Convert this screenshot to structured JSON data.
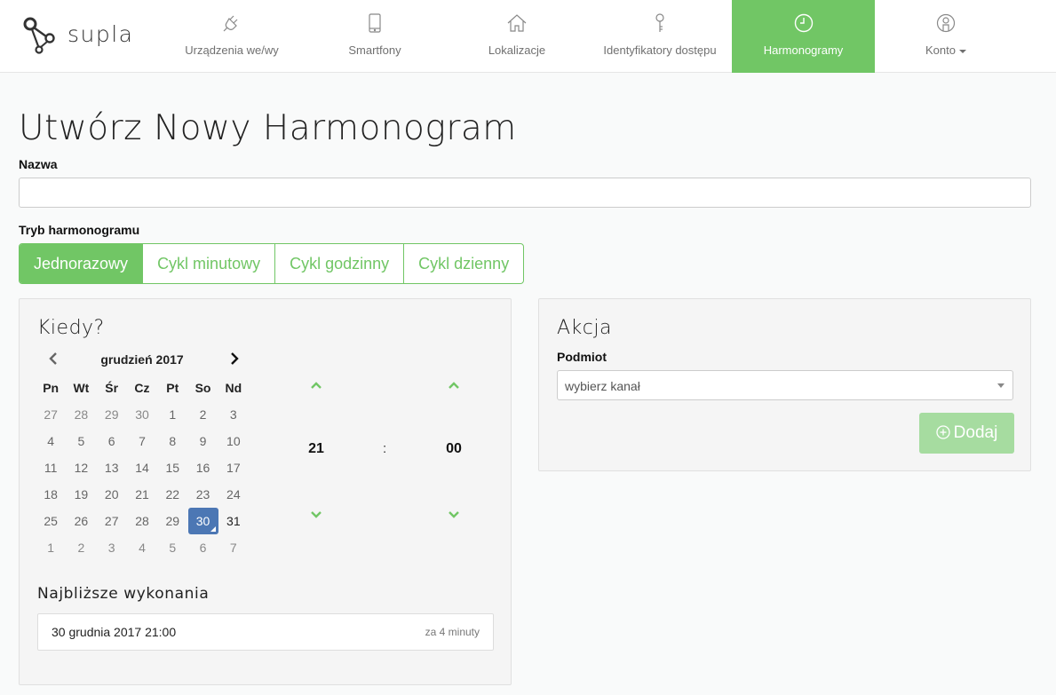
{
  "app": {
    "logo_text": "supla"
  },
  "nav": {
    "items": [
      {
        "label": "Urządzenia we/wy",
        "icon": "plug-icon"
      },
      {
        "label": "Smartfony",
        "icon": "smartphone-icon"
      },
      {
        "label": "Lokalizacje",
        "icon": "home-icon"
      },
      {
        "label": "Identyfikatory dostępu",
        "icon": "key-icon"
      },
      {
        "label": "Harmonogramy",
        "icon": "clock-icon",
        "active": true
      },
      {
        "label": "Konto",
        "icon": "user-icon",
        "dropdown": true
      }
    ]
  },
  "page": {
    "title": "Utwórz Nowy Harmonogram"
  },
  "form": {
    "name_label": "Nazwa",
    "name_value": "",
    "mode_label": "Tryb harmonogramu",
    "modes": [
      "Jednorazowy",
      "Cykl minutowy",
      "Cykl godzinny",
      "Cykl dzienny"
    ],
    "active_mode": "Jednorazowy"
  },
  "when": {
    "title": "Kiedy?",
    "calendar": {
      "month": "grudzień 2017",
      "weekdays": [
        "Pn",
        "Wt",
        "Śr",
        "Cz",
        "Pt",
        "So",
        "Nd"
      ],
      "weeks": [
        [
          "27",
          "28",
          "29",
          "30",
          "1",
          "2",
          "3"
        ],
        [
          "4",
          "5",
          "6",
          "7",
          "8",
          "9",
          "10"
        ],
        [
          "11",
          "12",
          "13",
          "14",
          "15",
          "16",
          "17"
        ],
        [
          "18",
          "19",
          "20",
          "21",
          "22",
          "23",
          "24"
        ],
        [
          "25",
          "26",
          "27",
          "28",
          "29",
          "30",
          "31"
        ],
        [
          "1",
          "2",
          "3",
          "4",
          "5",
          "6",
          "7"
        ]
      ],
      "selected": "30"
    },
    "time": {
      "hour": "21",
      "separator": ":",
      "minute": "00"
    },
    "next_title": "Najbliższe wykonania",
    "next_runs": [
      {
        "date": "30 grudnia 2017 21:00",
        "relative": "za 4 minuty"
      }
    ]
  },
  "action": {
    "title": "Akcja",
    "subject_label": "Podmiot",
    "subject_placeholder": "wybierz kanał",
    "add_label": "Dodaj"
  },
  "colors": {
    "accent": "#71c665",
    "accent_disabled": "#a6dca0",
    "selected_day": "#4c77b4"
  }
}
